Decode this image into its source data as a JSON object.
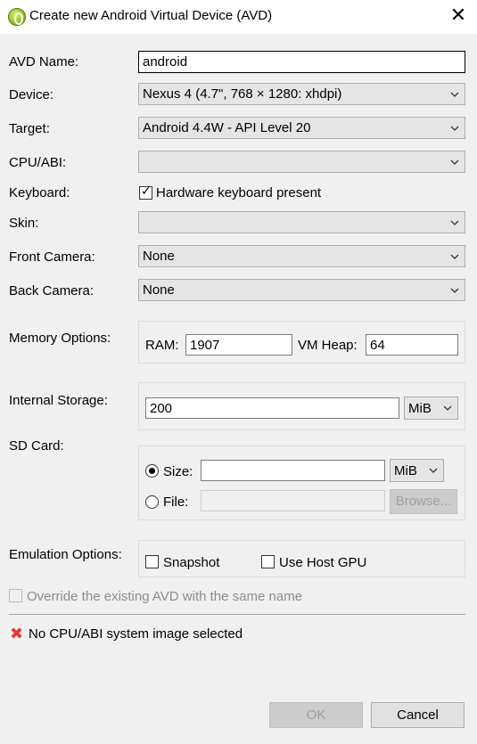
{
  "window": {
    "title": "Create new Android Virtual Device (AVD)"
  },
  "fields": {
    "avd_name": {
      "label": "AVD Name:",
      "value": "android"
    },
    "device": {
      "label": "Device:",
      "value": "Nexus 4 (4.7\", 768 × 1280: xhdpi)"
    },
    "target": {
      "label": "Target:",
      "value": "Android 4.4W - API Level 20"
    },
    "cpu_abi": {
      "label": "CPU/ABI:",
      "value": ""
    },
    "keyboard": {
      "label": "Keyboard:",
      "checkbox_label": "Hardware keyboard present",
      "checked": true
    },
    "skin": {
      "label": "Skin:",
      "value": ""
    },
    "front_camera": {
      "label": "Front Camera:",
      "value": "None"
    },
    "back_camera": {
      "label": "Back Camera:",
      "value": "None"
    }
  },
  "memory": {
    "label": "Memory Options:",
    "ram_label": "RAM:",
    "ram_value": "1907",
    "vm_heap_label": "VM Heap:",
    "vm_heap_value": "64"
  },
  "internal_storage": {
    "label": "Internal Storage:",
    "value": "200",
    "unit": "MiB"
  },
  "sd_card": {
    "label": "SD Card:",
    "size_label": "Size:",
    "size_value": "",
    "size_unit": "MiB",
    "file_label": "File:",
    "file_value": "",
    "browse_label": "Browse..."
  },
  "emulation": {
    "label": "Emulation Options:",
    "snapshot_label": "Snapshot",
    "host_gpu_label": "Use Host GPU"
  },
  "override_label": "Override the existing AVD with the same name",
  "error_message": "No CPU/ABI system image selected",
  "buttons": {
    "ok": "OK",
    "cancel": "Cancel"
  },
  "colors": {
    "error": "#e53935",
    "disabled_text": "#8c8c8c"
  }
}
